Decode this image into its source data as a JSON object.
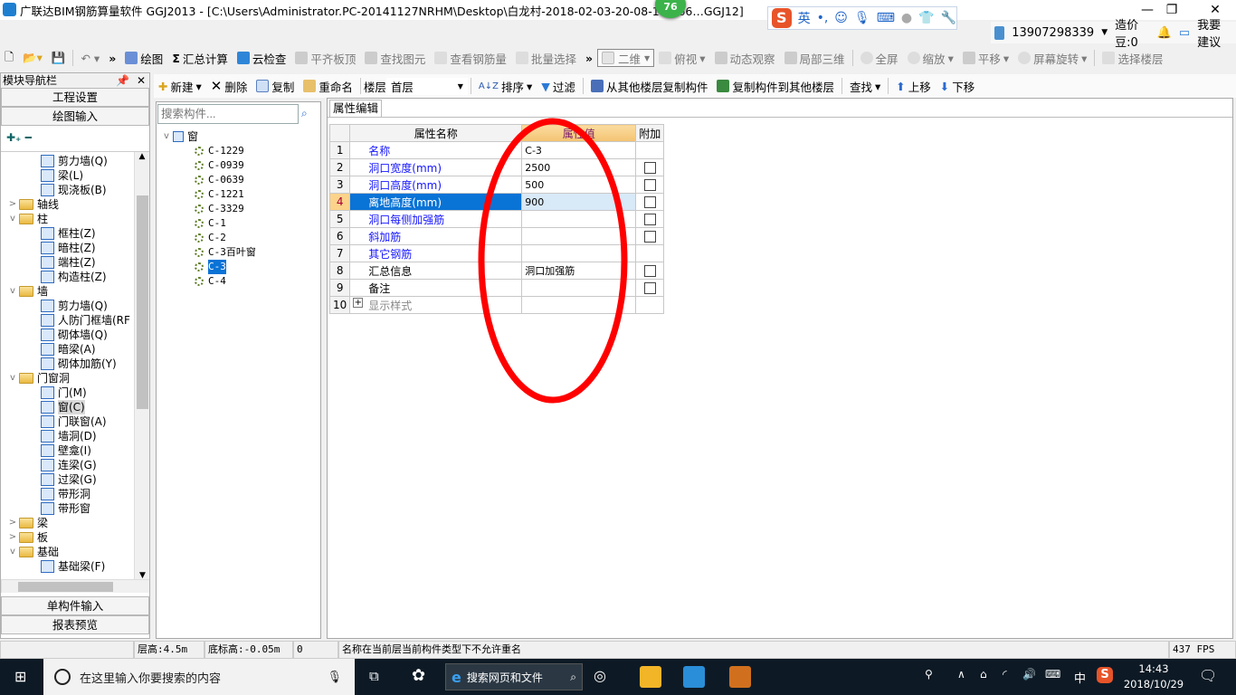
{
  "window": {
    "title": "广联达BIM钢筋算量软件 GGJ2013 - [C:\\Users\\Administrator.PC-20141127NRHM\\Desktop\\白龙村-2018-02-03-20-08-17(266…GGJ12]",
    "badge": "76"
  },
  "ime": {
    "lang": "英",
    "punct": "•,"
  },
  "account": {
    "phone": "13907298339",
    "beans": "造价豆:0",
    "feedback": "我要建议"
  },
  "toolbar1": [
    "绘图",
    "汇总计算",
    "云检查",
    "平齐板顶",
    "查找图元",
    "查看钢筋量",
    "批量选择"
  ],
  "toolbar1_view": {
    "mode": "二维",
    "items": [
      "俯视",
      "动态观察",
      "局部三维",
      "全屏",
      "缩放",
      "平移",
      "屏幕旋转",
      "选择楼层"
    ]
  },
  "toolbar2": {
    "new": "新建",
    "delete": "删除",
    "copy": "复制",
    "rename": "重命名",
    "floor_label": "楼层",
    "floor": "首层",
    "sort": "排序",
    "filter": "过滤",
    "copy_from": "从其他楼层复制构件",
    "copy_to": "复制构件到其他楼层",
    "find": "查找",
    "up": "上移",
    "down": "下移"
  },
  "nav": {
    "title": "模块导航栏",
    "buttons": [
      "工程设置",
      "绘图输入"
    ],
    "bottom": [
      "单构件输入",
      "报表预览"
    ],
    "tree": [
      {
        "l": 2,
        "t": "剪力墙(Q)"
      },
      {
        "l": 2,
        "t": "梁(L)"
      },
      {
        "l": 2,
        "t": "现浇板(B)"
      },
      {
        "l": 0,
        "t": "轴线",
        "f": ">"
      },
      {
        "l": 0,
        "t": "柱",
        "f": "v"
      },
      {
        "l": 2,
        "t": "框柱(Z)"
      },
      {
        "l": 2,
        "t": "暗柱(Z)"
      },
      {
        "l": 2,
        "t": "端柱(Z)"
      },
      {
        "l": 2,
        "t": "构造柱(Z)"
      },
      {
        "l": 0,
        "t": "墙",
        "f": "v"
      },
      {
        "l": 2,
        "t": "剪力墙(Q)"
      },
      {
        "l": 2,
        "t": "人防门框墙(RF"
      },
      {
        "l": 2,
        "t": "砌体墙(Q)"
      },
      {
        "l": 2,
        "t": "暗梁(A)"
      },
      {
        "l": 2,
        "t": "砌体加筋(Y)"
      },
      {
        "l": 0,
        "t": "门窗洞",
        "f": "v"
      },
      {
        "l": 2,
        "t": "门(M)"
      },
      {
        "l": 2,
        "t": "窗(C)",
        "sel": true
      },
      {
        "l": 2,
        "t": "门联窗(A)"
      },
      {
        "l": 2,
        "t": "墙洞(D)"
      },
      {
        "l": 2,
        "t": "壁龛(I)"
      },
      {
        "l": 2,
        "t": "连梁(G)"
      },
      {
        "l": 2,
        "t": "过梁(G)"
      },
      {
        "l": 2,
        "t": "带形洞"
      },
      {
        "l": 2,
        "t": "带形窗"
      },
      {
        "l": 0,
        "t": "梁",
        "f": ">"
      },
      {
        "l": 0,
        "t": "板",
        "f": ">"
      },
      {
        "l": 0,
        "t": "基础",
        "f": "v"
      },
      {
        "l": 2,
        "t": "基础梁(F)"
      }
    ]
  },
  "components": {
    "search_placeholder": "搜索构件...",
    "root": "窗",
    "items": [
      "C-1229",
      "C-0939",
      "C-0639",
      "C-1221",
      "C-3329",
      "C-1",
      "C-2",
      "C-3百叶窗",
      "C-3",
      "C-4"
    ],
    "selected": "C-3"
  },
  "properties": {
    "tab": "属性编辑",
    "headers": [
      "属性名称",
      "属性值",
      "附加"
    ],
    "rows": [
      {
        "n": "1",
        "name": "名称",
        "value": "C-3",
        "blue": true,
        "cb": false
      },
      {
        "n": "2",
        "name": "洞口宽度(mm)",
        "value": "2500",
        "blue": true,
        "cb": true
      },
      {
        "n": "3",
        "name": "洞口高度(mm)",
        "value": "500",
        "blue": true,
        "cb": true
      },
      {
        "n": "4",
        "name": "离地高度(mm)",
        "value": "900",
        "blue": true,
        "cb": true,
        "sel": true
      },
      {
        "n": "5",
        "name": "洞口每侧加强筋",
        "value": "",
        "blue": true,
        "cb": true
      },
      {
        "n": "6",
        "name": "斜加筋",
        "value": "",
        "blue": true,
        "cb": true
      },
      {
        "n": "7",
        "name": "其它钢筋",
        "value": "",
        "blue": true,
        "cb": false
      },
      {
        "n": "8",
        "name": "汇总信息",
        "value": "洞口加强筋",
        "blue": false,
        "cb": true
      },
      {
        "n": "9",
        "name": "备注",
        "value": "",
        "blue": false,
        "cb": true
      },
      {
        "n": "10",
        "name": "显示样式",
        "value": "",
        "gray": true,
        "cb": false,
        "plus": true
      }
    ]
  },
  "status": {
    "floor_height": "层高:4.5m",
    "base_height": "底标高:-0.05m",
    "num": "0",
    "message": "名称在当前层当前构件类型下不允许重名",
    "fps": "437 FPS"
  },
  "taskbar": {
    "search": "在这里输入你要搜索的内容",
    "browser_search": "搜索网页和文件",
    "ime": "中",
    "time": "14:43",
    "date": "2018/10/29"
  },
  "annotation_color": "#ff0000"
}
